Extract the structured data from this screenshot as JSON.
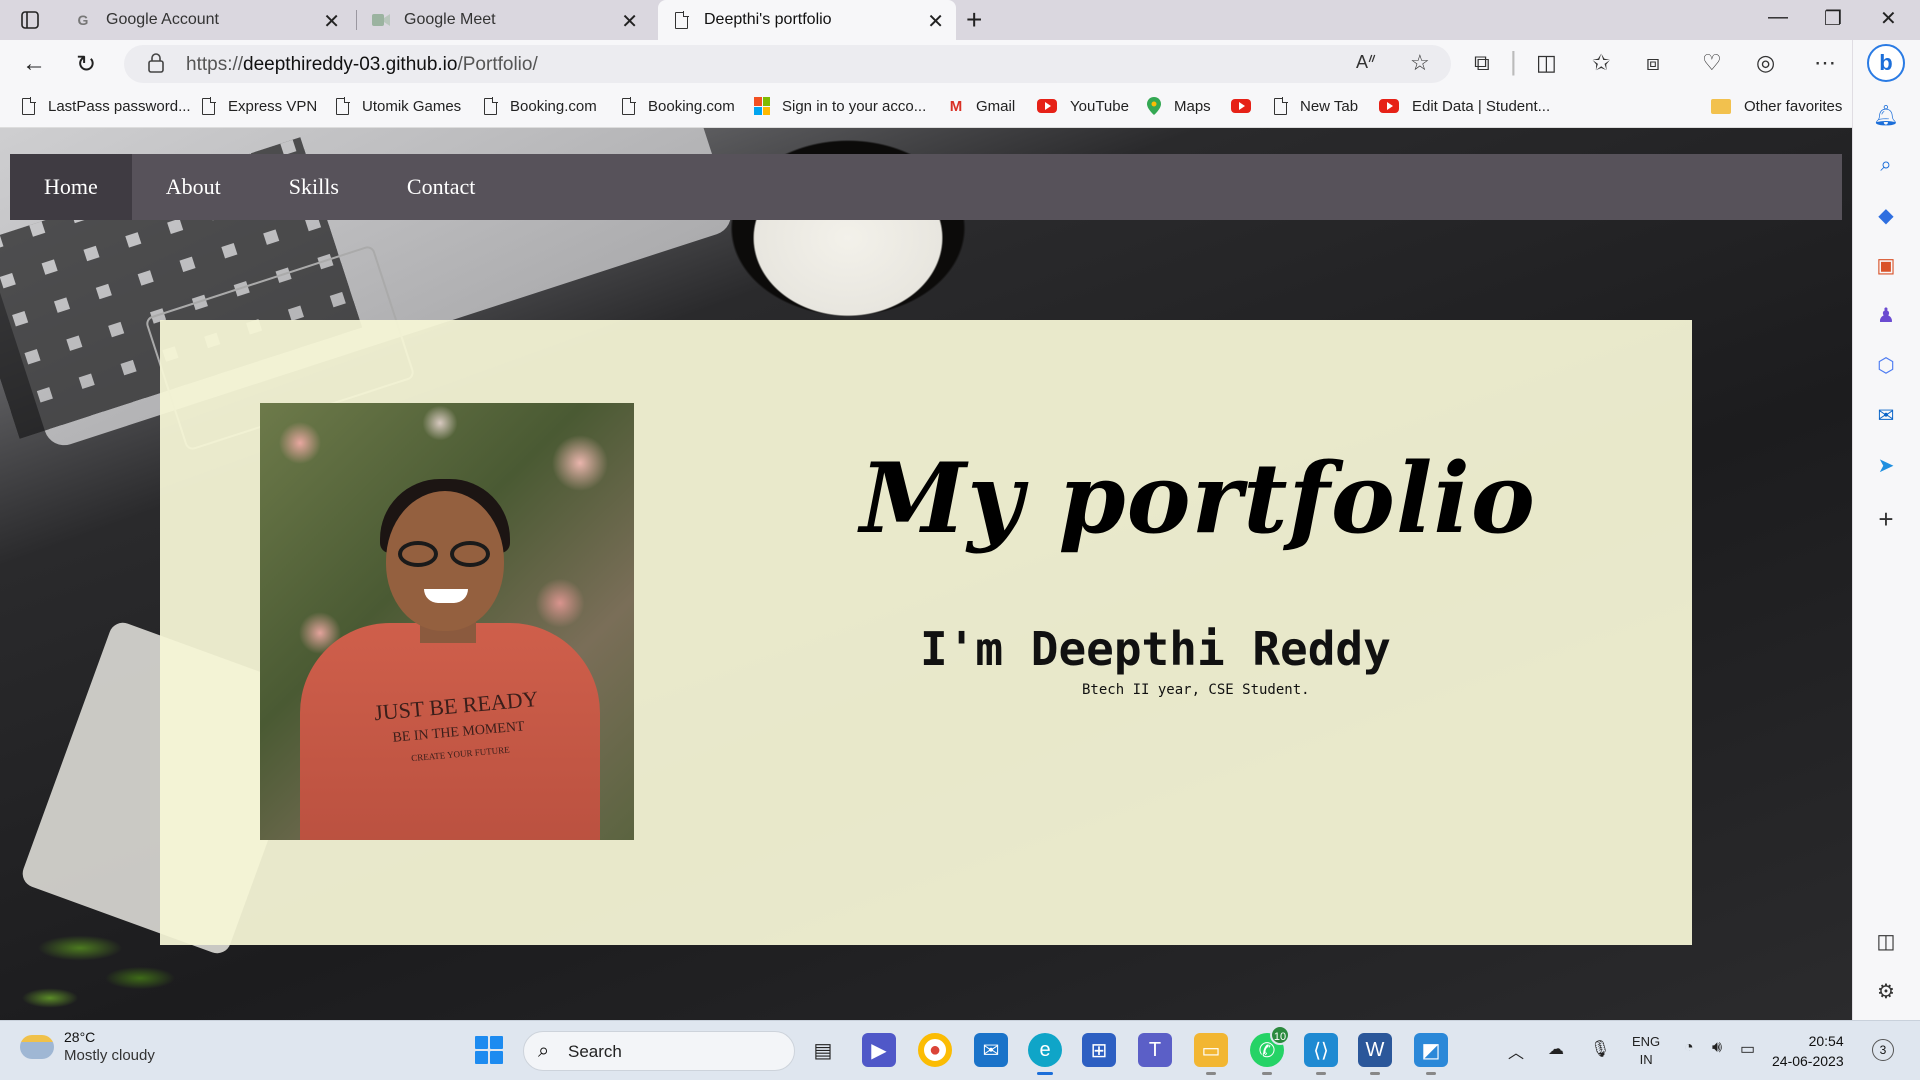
{
  "browser": {
    "tabs": [
      {
        "title": "Google Account",
        "icon": "google-g-icon"
      },
      {
        "title": "Google Meet",
        "icon": "google-meet-icon"
      },
      {
        "title": "Deepthi's portfolio",
        "icon": "page-icon",
        "active": true
      }
    ],
    "url_prefix": "https://",
    "url_host": "deepthireddy-03.github.io",
    "url_path": "/Portfolio/"
  },
  "bookmarks": [
    {
      "label": "LastPass password...",
      "icon": "page-icon"
    },
    {
      "label": "Express VPN",
      "icon": "page-icon"
    },
    {
      "label": "Utomik Games",
      "icon": "page-icon"
    },
    {
      "label": "Booking.com",
      "icon": "page-icon"
    },
    {
      "label": "Booking.com",
      "icon": "page-icon"
    },
    {
      "label": "Sign in to your acco...",
      "icon": "microsoft-icon"
    },
    {
      "label": "Gmail",
      "icon": "gmail-icon"
    },
    {
      "label": "YouTube",
      "icon": "youtube-icon"
    },
    {
      "label": "Maps",
      "icon": "maps-pin-icon"
    },
    {
      "label": "",
      "icon": "youtube-icon"
    },
    {
      "label": "New Tab",
      "icon": "page-icon"
    },
    {
      "label": "Edit Data | Student...",
      "icon": "youtube-icon"
    }
  ],
  "other_favorites": "Other favorites",
  "site": {
    "nav": [
      "Home",
      "About",
      "Skills",
      "Contact"
    ],
    "title": "My portfolio",
    "name": "I'm Deepthi Reddy",
    "subtitle": "Btech II year, CSE Student.",
    "shirt_lines": [
      "JUST BE READY",
      "BE IN THE MOMENT",
      "CREATE YOUR FUTURE"
    ]
  },
  "taskbar": {
    "weather_temp": "28°C",
    "weather_desc": "Mostly cloudy",
    "search_label": "Search",
    "whatsapp_badge": "10",
    "lang_line1": "ENG",
    "lang_line2": "IN",
    "time": "20:54",
    "date": "24-06-2023",
    "notifications": "3"
  }
}
